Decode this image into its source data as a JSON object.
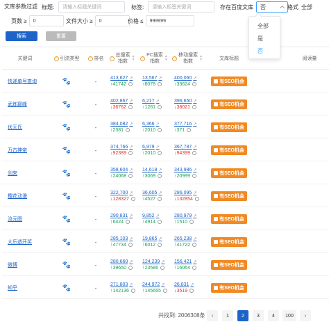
{
  "filters": {
    "label": "文库参数过滤",
    "title_label": "标题:",
    "title_placeholder": "请输入标题关键词",
    "tag_label": "标签:",
    "tag_placeholder": "请输入标签关键词",
    "in_baidu_label": "存在百度文库",
    "in_baidu_value": "否",
    "format_label": "格式",
    "format_value": "全部",
    "pages_label": "页数 ≥",
    "pages_value": "0",
    "size_label": "文件大小 ≥",
    "size_value": "0",
    "price_label": "价格 ≤",
    "price_value": "999999",
    "search_button": "搜索",
    "clear_button": "重置"
  },
  "dropdown": {
    "options": [
      "全部",
      "是",
      "否"
    ],
    "selected": "否"
  },
  "table": {
    "headers": {
      "keyword": "关键词",
      "traffic_type": "引流类型",
      "rank": "排名",
      "total_index": "总搜索\n指数",
      "pc_index": "PC搜索\n指数",
      "mobile_index": "移动搜索\n指数",
      "doc_title": "文库标题",
      "views": "阅读量"
    },
    "seo_label": "有SEO机会",
    "rows": [
      {
        "keyword": "快递单号查询",
        "rank": "-",
        "total": "413,627",
        "total_delta": "↑41742",
        "total_dir": "up",
        "pc": "13,567",
        "pc_delta": "↑8078",
        "pc_dir": "up",
        "mobile": "400,060",
        "mobile_delta": "↑33624",
        "mobile_dir": "up"
      },
      {
        "keyword": "武炼巅峰",
        "rank": "-",
        "total": "402,867",
        "total_delta": "↓36762",
        "total_dir": "down",
        "pc": "6,217",
        "pc_delta": "↑1261",
        "pc_dir": "up",
        "mobile": "396,650",
        "mobile_delta": "↓38021",
        "mobile_dir": "down"
      },
      {
        "keyword": "伏天氏",
        "rank": "-",
        "total": "384,082",
        "total_delta": "↑2381",
        "total_dir": "up",
        "pc": "6,366",
        "pc_delta": "↑2010",
        "pc_dir": "up",
        "mobile": "377,716",
        "mobile_delta": "↑371",
        "mobile_dir": "up"
      },
      {
        "keyword": "万古神帝",
        "rank": "-",
        "total": "374,766",
        "total_delta": "↓92389",
        "total_dir": "down",
        "pc": "6,979",
        "pc_delta": "↑2010",
        "pc_dir": "up",
        "mobile": "367,787",
        "mobile_delta": "↓94399",
        "mobile_dir": "down"
      },
      {
        "keyword": "剑来",
        "rank": "-",
        "total": "358,604",
        "total_delta": "↑24068",
        "total_dir": "up",
        "pc": "14,618",
        "pc_delta": "↑3069",
        "pc_dir": "up",
        "mobile": "343,986",
        "mobile_delta": "↑20999",
        "mobile_dir": "up"
      },
      {
        "keyword": "樱花动漫",
        "rank": "-",
        "total": "322,700",
        "total_delta": "↓128327",
        "total_dir": "down",
        "pc": "36,605",
        "pc_delta": "↑4527",
        "pc_dir": "up",
        "mobile": "286,095",
        "mobile_delta": "↓132854",
        "mobile_dir": "down"
      },
      {
        "keyword": "沧元图",
        "rank": "-",
        "total": "290,831",
        "total_delta": "↑6424",
        "total_dir": "up",
        "pc": "9,852",
        "pc_delta": "↑4914",
        "pc_dir": "up",
        "mobile": "280,979",
        "mobile_delta": "↑1510",
        "mobile_dir": "up"
      },
      {
        "keyword": "大乐透开奖",
        "rank": "-",
        "total": "285,103",
        "total_delta": "↑47734",
        "total_dir": "up",
        "pc": "19,865",
        "pc_delta": "↑6012",
        "pc_dir": "up",
        "mobile": "265,238",
        "mobile_delta": "↑41722",
        "mobile_dir": "up"
      },
      {
        "keyword": "微博",
        "rank": "-",
        "total": "280,660",
        "total_delta": "↑39650",
        "total_dir": "up",
        "pc": "124,239",
        "pc_delta": "↑23586",
        "pc_dir": "up",
        "mobile": "156,421",
        "mobile_delta": "↑16064",
        "mobile_dir": "up"
      },
      {
        "keyword": "知乎",
        "rank": "-",
        "total": "271,803",
        "total_delta": "↑142136",
        "total_dir": "up",
        "pc": "244,972",
        "pc_delta": "↑145655",
        "pc_dir": "up",
        "mobile": "26,831",
        "mobile_delta": "↓3519",
        "mobile_dir": "down"
      }
    ]
  },
  "pagination": {
    "total_text": "共找到: 2006308条",
    "prev": "‹",
    "next": "›",
    "pages": [
      "1",
      "2",
      "3",
      "4",
      "100"
    ],
    "current": "2"
  }
}
